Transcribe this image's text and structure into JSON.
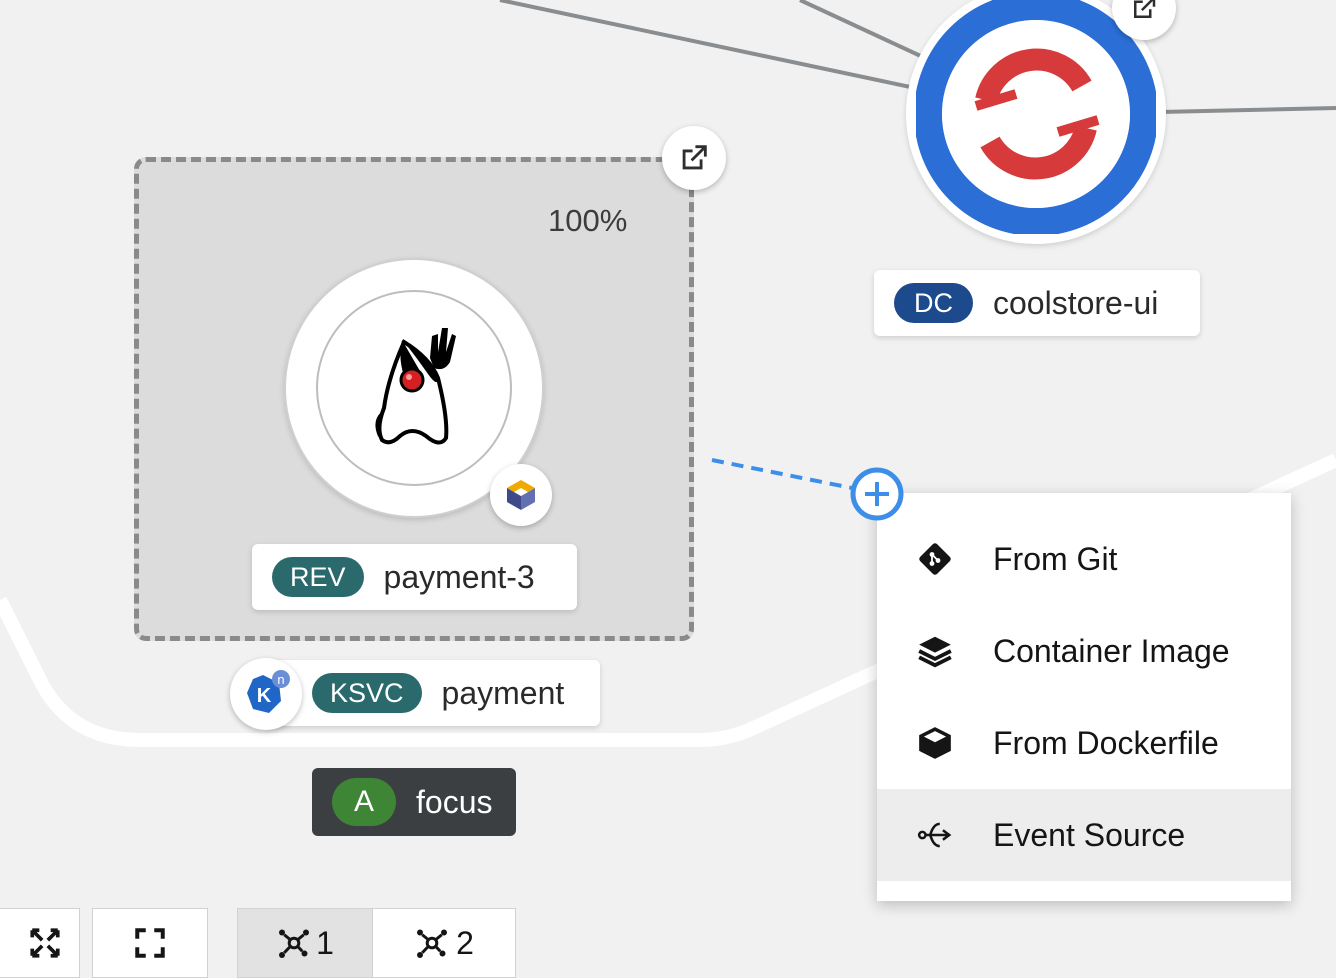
{
  "traffic": {
    "percent": "100%"
  },
  "revision": {
    "badge": "REV",
    "name": "payment-3",
    "badge_color": "#2b6a6c"
  },
  "knative_service": {
    "badge": "KSVC",
    "name": "payment",
    "badge_color": "#2b6a6c",
    "icon_letter": "K",
    "icon_sup": "n"
  },
  "deployment_config": {
    "badge": "DC",
    "name": "coolstore-ui",
    "badge_color": "#1c4a8c"
  },
  "application": {
    "badge": "A",
    "name": "focus",
    "badge_color": "#3e8635"
  },
  "context_menu": {
    "items": [
      {
        "label": "From Git",
        "icon": "git-icon"
      },
      {
        "label": "Container Image",
        "icon": "layers-icon"
      },
      {
        "label": "From Dockerfile",
        "icon": "cube-icon"
      },
      {
        "label": "Event Source",
        "icon": "event-source-icon"
      }
    ],
    "hovered_index": 3
  },
  "toolbar": {
    "layout1_label": "1",
    "layout2_label": "2",
    "active_layout": 1
  },
  "colors": {
    "accent_blue": "#2b6ed6",
    "openshift_red": "#d73a3a",
    "connector_blue": "#3d8ee8"
  }
}
